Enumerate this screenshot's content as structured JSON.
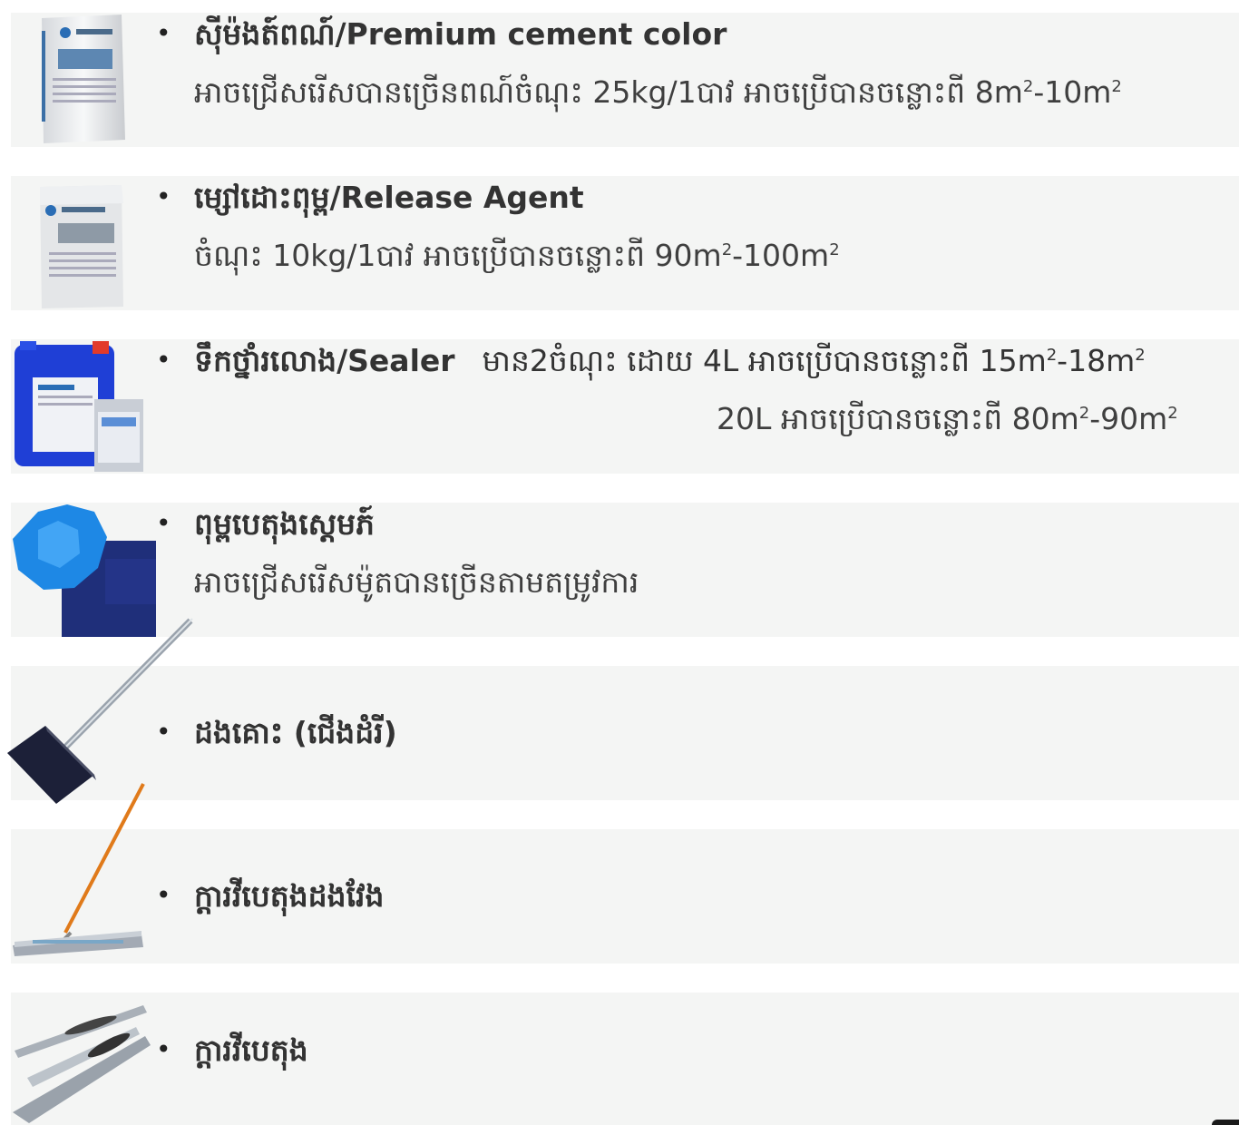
{
  "items": [
    {
      "title": "ស៊ីម៉ងត៍ពណ៍/Premium cement color",
      "detail_a": "អាចជ្រើសរើសបានច្រើនពណ៍ចំណុះ 25kg/1បាវ អាចប្រើបានចន្លោះពី 8m",
      "detail_b": "-10m",
      "image_icon": "cement-bag-icon"
    },
    {
      "title": "ម្សៅដោះពុម្ព/Release Agent",
      "detail_a": "ចំណុះ 10kg/1បាវ អាចប្រើបានចន្លោះពី 90m",
      "detail_b": "-100m",
      "image_icon": "release-agent-bag-icon"
    },
    {
      "title": "ទឹកថ្នាំរលោង/Sealer",
      "detail_a": "មាន2ចំណុះ ដោយ 4L អាចប្រើបានចន្លោះពី 15m",
      "detail_b": "-18m",
      "detail2_a": "20L អាចប្រើបានចន្លោះពី 80m",
      "detail2_b": "-90m",
      "image_icon": "sealer-containers-icon"
    },
    {
      "title": "ពុម្ពបេតុងស្តេមភ៍",
      "detail": "អាចជ្រើសរើសម៉ូតបានច្រើនតាមតម្រូវការ",
      "image_icon": "stamp-mold-icon"
    },
    {
      "title": "ដងគោះ (ជើងដំរី)",
      "image_icon": "tamper-tool-icon"
    },
    {
      "title": "ក្តារវីបេតុងដងវែង",
      "image_icon": "bull-float-icon"
    },
    {
      "title": "ក្តារវីបេតុង",
      "image_icon": "hand-trowel-icon"
    }
  ],
  "sup": "2"
}
